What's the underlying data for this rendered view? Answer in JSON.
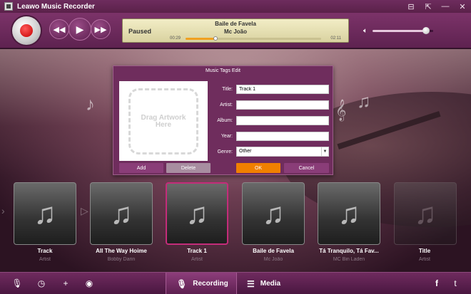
{
  "window": {
    "title": "Leawo Music Recorder",
    "buttons": [
      "⊟",
      "⇱",
      "—",
      "✕"
    ]
  },
  "player": {
    "status": "Paused",
    "song": "Baile de Favela",
    "artist": "Mc João",
    "elapsed": "00:29",
    "duration": "02:11",
    "progress_fraction": 0.22,
    "volume_fraction": 0.88
  },
  "dialog": {
    "title": "Music Tags Edit",
    "artwork_placeholder": "Drag Artwork Here",
    "labels": {
      "title": "Title:",
      "artist": "Artist:",
      "album": "Album:",
      "year": "Year:",
      "genre": "Genre:"
    },
    "values": {
      "title": "Track 1",
      "artist": "",
      "album": "",
      "year": "",
      "genre": "Other"
    },
    "buttons": {
      "add": "Add",
      "delete": "Delete",
      "ok": "OK",
      "cancel": "Cancel"
    }
  },
  "tracks": [
    {
      "name": "Track",
      "artist": "Artist"
    },
    {
      "name": "All The Way Hoime",
      "artist": "Bobby Darin"
    },
    {
      "name": "Track 1",
      "artist": "Artist"
    },
    {
      "name": "Baile de Favela",
      "artist": "Mc João"
    },
    {
      "name": "Tá Tranquilo, Tá Fav...",
      "artist": "MC Bin Laden"
    },
    {
      "name": "Title",
      "artist": "Artist"
    }
  ],
  "bottombar": {
    "tabs": {
      "recording": "Recording",
      "media": "Media"
    },
    "icons": [
      "microphone-icon",
      "clock-icon",
      "plus-icon",
      "disc-icon",
      "facebook-icon",
      "twitter-icon"
    ]
  },
  "colors": {
    "accent": "#f08000",
    "primary": "#6f2d5d",
    "selected_border": "#c42c7a"
  }
}
